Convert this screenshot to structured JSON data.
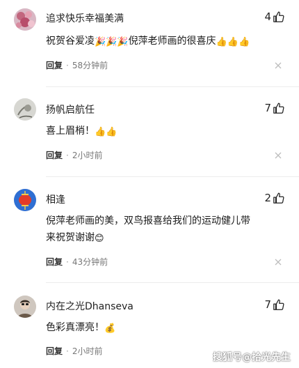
{
  "comments": [
    {
      "username": "追求快乐幸福美满",
      "likes": "4",
      "text_parts": [
        "祝贺谷爱凌",
        "🎉",
        "🎉",
        "🎉",
        "倪萍老师画的很喜庆",
        "👍",
        "👍",
        "👍"
      ],
      "reply": "回复",
      "time": "58分钟前",
      "avatar_icon": "flower-photo-icon"
    },
    {
      "username": "扬帆启航任",
      "likes": "7",
      "text_parts": [
        "喜上眉梢！",
        "👍",
        "👍"
      ],
      "reply": "回复",
      "time": "2小时前",
      "avatar_icon": "sketch-photo-icon"
    },
    {
      "username": "相逢",
      "likes": "2",
      "text_line1": "倪萍老师画的美，双鸟报喜给我们的运动健儿带",
      "text_line2": "来祝贺谢谢",
      "text_emoji": "😊",
      "reply": "回复",
      "time": "43分钟前",
      "avatar_icon": "lantern-icon"
    },
    {
      "username": "内在之光Dhanseva",
      "likes": "7",
      "text_parts": [
        "色彩真漂亮！",
        "💰"
      ],
      "reply": "回复",
      "time": "2小时前",
      "avatar_icon": "person-photo-icon"
    }
  ],
  "watermark": "搜狐号@拾光先生",
  "colors": {
    "text": "#1a1a1a",
    "meta": "#777777",
    "divider": "#ececec"
  }
}
